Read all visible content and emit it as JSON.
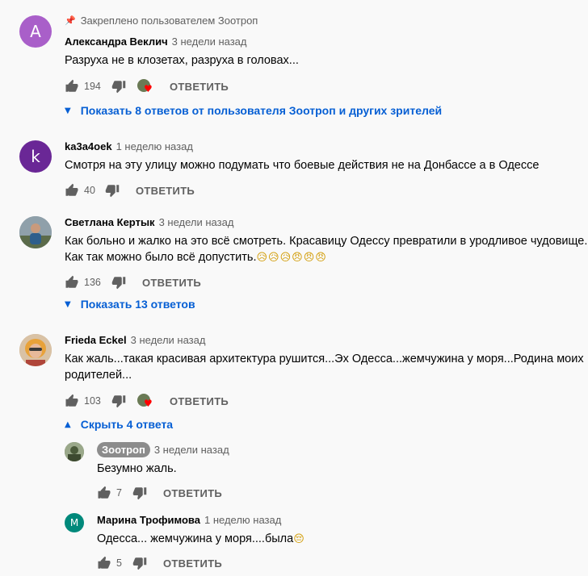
{
  "colors": {
    "link": "#065fd4",
    "secondary": "#606060",
    "primary": "#030303",
    "background": "#f9f9f9"
  },
  "comments": [
    {
      "pinned_note": "Закреплено пользователем Зоотроп",
      "avatar_letter": "А",
      "avatar_color": "#a95fc9",
      "author": "Александра Веклич",
      "time": "3 недели назад",
      "lines": [
        "Разруха не в клозетах, разруха в головах..."
      ],
      "likes": "194",
      "hearted": true,
      "reply_label": "ОТВЕТИТЬ",
      "toggle": "Показать 8 ответов от пользователя Зоотроп и других зрителей",
      "toggle_icon": "chevron-down-icon"
    },
    {
      "avatar_letter": "k",
      "avatar_color": "#6a2796",
      "author": "ka3a4oek",
      "time": "1 неделю назад",
      "lines": [
        "Смотря на эту улицу можно подумать что боевые действия не на Донбассе а в Одессе"
      ],
      "likes": "40",
      "reply_label": "ОТВЕТИТЬ"
    },
    {
      "author": "Светлана Кертык",
      "time": "3 недели назад",
      "lines": [
        "Как больно и жалко на это всё смотреть. Красавицу Одессу превратили в уродливое чудовище.",
        "Как так можно было всё допустить."
      ],
      "emojis": "😥😥😥😠😠😠",
      "likes": "136",
      "reply_label": "ОТВЕТИТЬ",
      "toggle": "Показать 13 ответов",
      "toggle_icon": "chevron-down-icon"
    },
    {
      "author": "Frieda Eckel",
      "time": "3 недели назад",
      "lines": [
        "Как жаль...такая красивая архитектура рушится...Эх Одесса...жемчужина у моря...Родина моих",
        "родителей..."
      ],
      "likes": "103",
      "hearted": true,
      "reply_label": "ОТВЕТИТЬ",
      "toggle": "Скрыть 4 ответа",
      "toggle_icon": "chevron-up-icon"
    }
  ],
  "replies": [
    {
      "author": "Зоотроп",
      "is_channel_owner": true,
      "time": "3 недели назад",
      "text": "Безумно жаль.",
      "likes": "7",
      "reply_label": "ОТВЕТИТЬ"
    },
    {
      "avatar_letter": "М",
      "avatar_color": "#00897b",
      "author": "Марина Трофимова",
      "time": "1 неделю назад",
      "text": "Одесса... жемчужина у моря....была",
      "emoji": "😔",
      "likes": "5",
      "reply_label": "ОТВЕТИТЬ"
    }
  ]
}
